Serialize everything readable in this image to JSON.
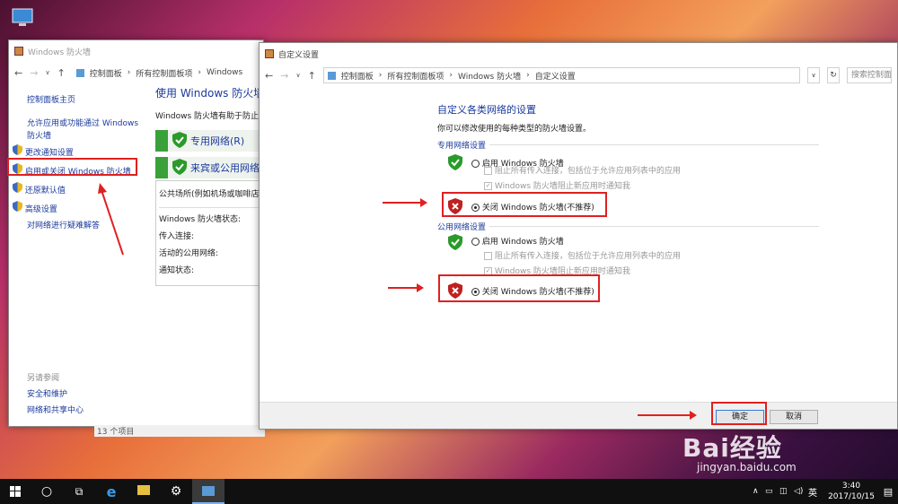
{
  "desktop": {
    "icon": "computer-icon"
  },
  "back_window": {
    "title": "Windows 防火墙",
    "breadcrumb": [
      "控制面板",
      "所有控制面板项",
      "Windows"
    ],
    "sidebar": {
      "home": "控制面板主页",
      "items": [
        "允许应用或功能通过 Windows",
        "防火墙",
        "更改通知设置",
        "启用或关闭 Windows 防火墙",
        "还原默认值",
        "高级设置",
        "对网络进行疑难解答"
      ],
      "see_also": "另请参阅",
      "links": [
        "安全和维护",
        "网络和共享中心"
      ]
    },
    "main": {
      "title": "使用 Windows 防火墙",
      "desc": "Windows 防火墙有助于防止黑",
      "private": "专用网络(R)",
      "public": "来宾或公用网络",
      "public_desc": "公共场所(例如机场或咖啡店)",
      "rows": [
        "Windows 防火墙状态:",
        "传入连接:",
        "活动的公用网络:",
        "通知状态:"
      ]
    },
    "status": "13 个项目"
  },
  "dialog": {
    "title": "自定义设置",
    "breadcrumb": [
      "控制面板",
      "所有控制面板项",
      "Windows 防火墙",
      "自定义设置"
    ],
    "search_placeholder": "搜索控制面板",
    "heading": "自定义各类网络的设置",
    "subheading": "你可以修改使用的每种类型的防火墙设置。",
    "private": {
      "label": "专用网络设置",
      "enable": "启用 Windows 防火墙",
      "block": "阻止所有传入连接，包括位于允许应用列表中的应用",
      "notify": "Windows 防火墙阻止新应用时通知我",
      "disable": "关闭 Windows 防火墙(不推荐)"
    },
    "public": {
      "label": "公用网络设置",
      "enable": "启用 Windows 防火墙",
      "block": "阻止所有传入连接，包括位于允许应用列表中的应用",
      "notify": "Windows 防火墙阻止新应用时通知我",
      "disable": "关闭 Windows 防火墙(不推荐)"
    },
    "ok": "确定",
    "cancel": "取消"
  },
  "watermark": {
    "text": "Bai经验",
    "url": "jingyan.baidu.com"
  },
  "taskbar": {
    "time": "3:40",
    "date": "2017/10/15",
    "ime": "英"
  },
  "colors": {
    "accent": "#1a3a9c",
    "highlight": "#e02020",
    "shield_green": "#2a9a2a",
    "shield_red": "#c02020"
  }
}
